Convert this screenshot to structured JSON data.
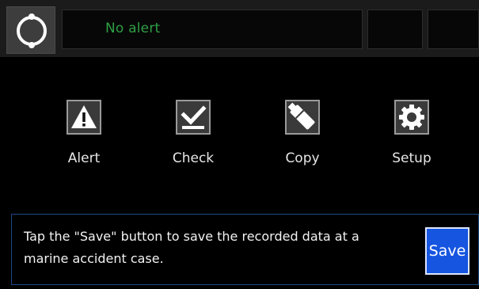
{
  "header": {
    "status_icon": "circle-status-icon",
    "alert_text": "No alert"
  },
  "menu": {
    "items": [
      {
        "label": "Alert",
        "icon": "warning-icon"
      },
      {
        "label": "Check",
        "icon": "checkmark-icon"
      },
      {
        "label": "Copy",
        "icon": "usb-drive-icon"
      },
      {
        "label": "Setup",
        "icon": "gear-icon"
      }
    ]
  },
  "message": {
    "text": "Tap the \"Save\" button to save the recorded data at a marine accident case.",
    "save_label": "Save"
  },
  "colors": {
    "background": "#000000",
    "alert_text": "#2f9f45",
    "save_button": "#1555e0",
    "panel_border": "#1c4a8a"
  }
}
